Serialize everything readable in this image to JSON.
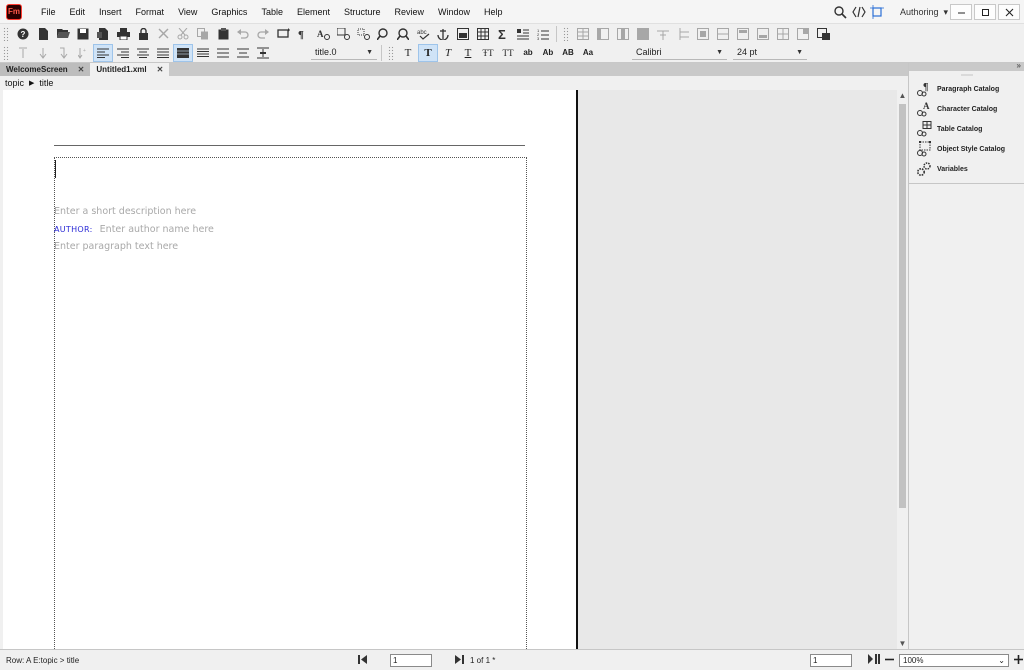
{
  "app": {
    "logo_text": "Fm"
  },
  "menu": [
    "File",
    "Edit",
    "Insert",
    "Format",
    "View",
    "Graphics",
    "Table",
    "Element",
    "Structure",
    "Review",
    "Window",
    "Help"
  ],
  "topright": {
    "workspace": "Authoring"
  },
  "format_toolbar": {
    "paragraph_tag": "title.0",
    "font": "Calibri",
    "size": "24 pt",
    "char_buttons": [
      "T",
      "T",
      "T",
      "T",
      "ŦT",
      "TT",
      "ab",
      "Ab",
      "AB",
      "Aa"
    ]
  },
  "tabs": [
    {
      "label": "WelcomeScreen",
      "active": false
    },
    {
      "label": "Untitled1.xml",
      "active": true
    }
  ],
  "breadcrumb": {
    "parent": "topic",
    "child": "title"
  },
  "document": {
    "short_desc_placeholder": "Enter a short description here",
    "author_label": "AUTHOR:",
    "author_placeholder": "Enter author name here",
    "paragraph_placeholder": "Enter paragraph text here"
  },
  "right_panel": {
    "items": [
      {
        "label": "Paragraph Catalog",
        "icon": "paragraph-catalog-icon"
      },
      {
        "label": "Character Catalog",
        "icon": "character-catalog-icon"
      },
      {
        "label": "Table Catalog",
        "icon": "table-catalog-icon"
      },
      {
        "label": "Object Style Catalog",
        "icon": "object-style-catalog-icon"
      },
      {
        "label": "Variables",
        "icon": "variables-icon"
      }
    ]
  },
  "status": {
    "left": "Row: A  E:topic > title",
    "page_input": "1",
    "page_count": "1 of 1 *",
    "right_input": "1",
    "zoom": "100%"
  }
}
